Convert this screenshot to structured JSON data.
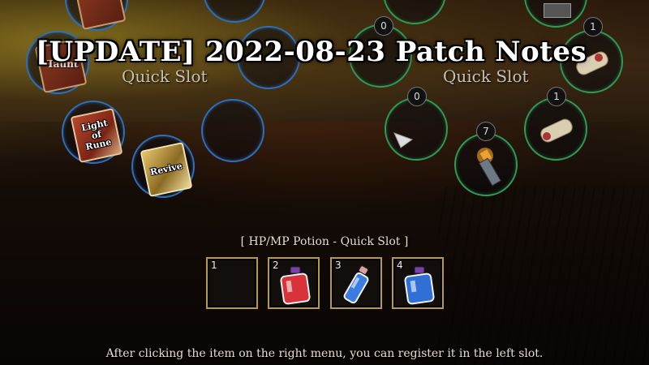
{
  "title": "[UPDATE] 2022-08-23 Patch Notes",
  "left_panel": {
    "quick_slot_label": "Quick Slot",
    "skills": [
      {
        "label": "Light of Rune",
        "label_lines": [
          "Light",
          "of",
          "Rune"
        ],
        "icon": "rune-book-icon"
      },
      {
        "label": "Revive",
        "icon": "revive-book-icon"
      }
    ],
    "partial_text": "Taunt"
  },
  "right_panel": {
    "quick_slot_label": "Quick Slot",
    "counts": {
      "top_a": "0",
      "top_b": "1",
      "mid_a": "0",
      "mid_b": "1",
      "lower": "7"
    }
  },
  "hp_mp": {
    "title": "[ HP/MP Potion - Quick Slot ]",
    "slots": [
      {
        "number": "1",
        "icon": "empty"
      },
      {
        "number": "2",
        "icon": "red-potion-icon",
        "color": "#d8333a"
      },
      {
        "number": "3",
        "icon": "blue-vial-icon",
        "color": "#3a7ce0"
      },
      {
        "number": "4",
        "icon": "blue-potion-icon",
        "color": "#2f6fd6"
      }
    ]
  },
  "footer": "After clicking the item on the right menu, you can register it in the left slot.",
  "colors": {
    "skill_ring": "#2f6fb8",
    "item_ring": "#2f9a55",
    "slot_border": "#b59a48"
  }
}
